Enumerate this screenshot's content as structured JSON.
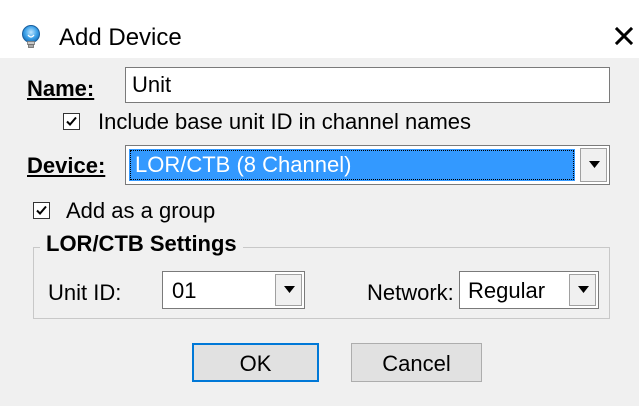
{
  "window": {
    "title": "Add Device",
    "close_label": "×",
    "icon": "lightbulb-icon"
  },
  "name_field": {
    "label": "Name:",
    "value": "Unit"
  },
  "include_base_unit": {
    "label": "Include base unit ID in channel names",
    "checked": true
  },
  "device_field": {
    "label": "Device:",
    "value": "LOR/CTB (8 Channel)"
  },
  "add_as_group": {
    "label": "Add as a group",
    "checked": true
  },
  "settings_group": {
    "title": "LOR/CTB Settings",
    "unit_id_label": "Unit ID:",
    "unit_id_value": "01",
    "network_label": "Network:",
    "network_value": "Regular"
  },
  "buttons": {
    "ok_label": "OK",
    "cancel_label": "Cancel"
  },
  "colors": {
    "selection": "#3399ff",
    "default_button_border": "#0078d7",
    "window_bg": "#f0f0f0"
  }
}
